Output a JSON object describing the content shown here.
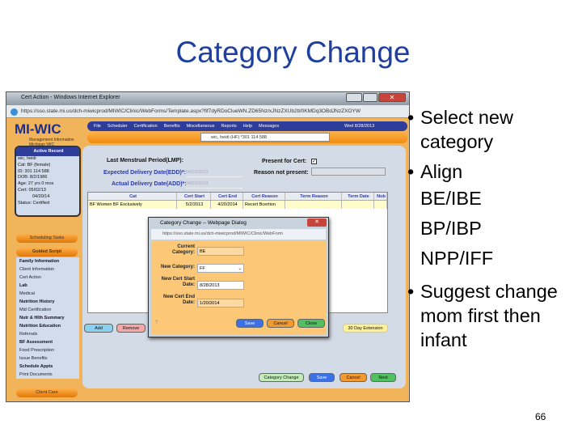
{
  "slide": {
    "title": "Category Change",
    "page_number": "66",
    "bullets": [
      {
        "lines": [
          "Select new",
          "category"
        ]
      },
      {
        "lines": [
          "Align",
          "BE/IBE",
          "BP/IBP",
          "NPP/IFF"
        ]
      },
      {
        "lines": [
          "Suggest change",
          "mom first then",
          "infant"
        ]
      }
    ]
  },
  "browser": {
    "title": "Cert Action - Windows Internet Explorer",
    "url": "https://sso.state.mi.us/dch-miwicprod/MIWIC/Clinic/WebForms/Template.aspx?fif7dyRDoClueWN.ZD65Nz/xJNzZXUb2tl/0KMDq3OBdJNzZXOYW"
  },
  "app": {
    "logo": "MI-WIC",
    "logo_sub": "Management Information Michigan WIC",
    "menu": [
      "File",
      "Scheduler",
      "Certification",
      "Benefits",
      "Miscellaneous",
      "Reports",
      "Help",
      "Messages"
    ],
    "date": "Wed 8/28/2013",
    "patient_select": "wic, heidi (HF) *301 114 588",
    "active_record": {
      "header": "Active Record",
      "name": "wic, heidi",
      "cat": "Cat: BF (female)",
      "id": "ID: 301 114 588",
      "dob": "DOB: 8/2/1986",
      "age": "Age: 27 yrs 0 mos",
      "cert1": "Cert: 05/02/13",
      "cert2": "04/20/14",
      "status": "Status: Certified"
    },
    "scheduling_tasks": "Scheduling Tasks",
    "guided_script": "Guided Script",
    "client_care": "Client Care",
    "guided_items": [
      "Family Information",
      "Client Information",
      "Cert Action",
      "Lab",
      "Medical",
      "Nutrition History",
      "Mid Certification",
      "Nutr & Hlth Summary",
      "Nutrition Education",
      "Referrals",
      "BF Assessment",
      "Food Prescription",
      "Issue Benefits",
      "Schedule Appts",
      "Print Documents"
    ],
    "form": {
      "lmp": "Last Menstrual Period(LMP):",
      "edd": "Expected Delivery Date(EDD)*:",
      "edd_val": "04/20/2013",
      "add": "Actual Delivery Date(ADD)*:",
      "add_val": "04/20/2013",
      "present": "Present for Cert:",
      "reason": "Reason not present:"
    },
    "grid": {
      "headers": [
        "Cat",
        "Cert Start",
        "Cert End",
        "Cert Reason",
        "Term Reason",
        "Term Date",
        "Nob"
      ],
      "rows": [
        [
          "BF Women BF Exclusively",
          "5/2/2013",
          "4/20/2014",
          "Recert Bcertion",
          "",
          "",
          ""
        ]
      ]
    },
    "buttons": {
      "add": "Add",
      "remove": "Remove",
      "extension": "30 Day Extension",
      "category_change": "Category Change",
      "save": "Save",
      "cancel": "Cancel",
      "next": "Next"
    },
    "dialog": {
      "title": "Category Change -- Webpage Dialog",
      "url": "https://sso.state.mi.us/dch-miwicprod/MIWIC/Clinic/WebForm",
      "current_label": "Current Category:",
      "current_val": "BE",
      "new_label": "New Category:",
      "new_val": "FF",
      "start_label": "New Cert Start Date:",
      "start_val": "8/28/2013",
      "end_label": "New Cert End Date:",
      "end_val": "1/20/2014",
      "save": "Save",
      "cancel": "Cancel",
      "close": "Close"
    }
  }
}
